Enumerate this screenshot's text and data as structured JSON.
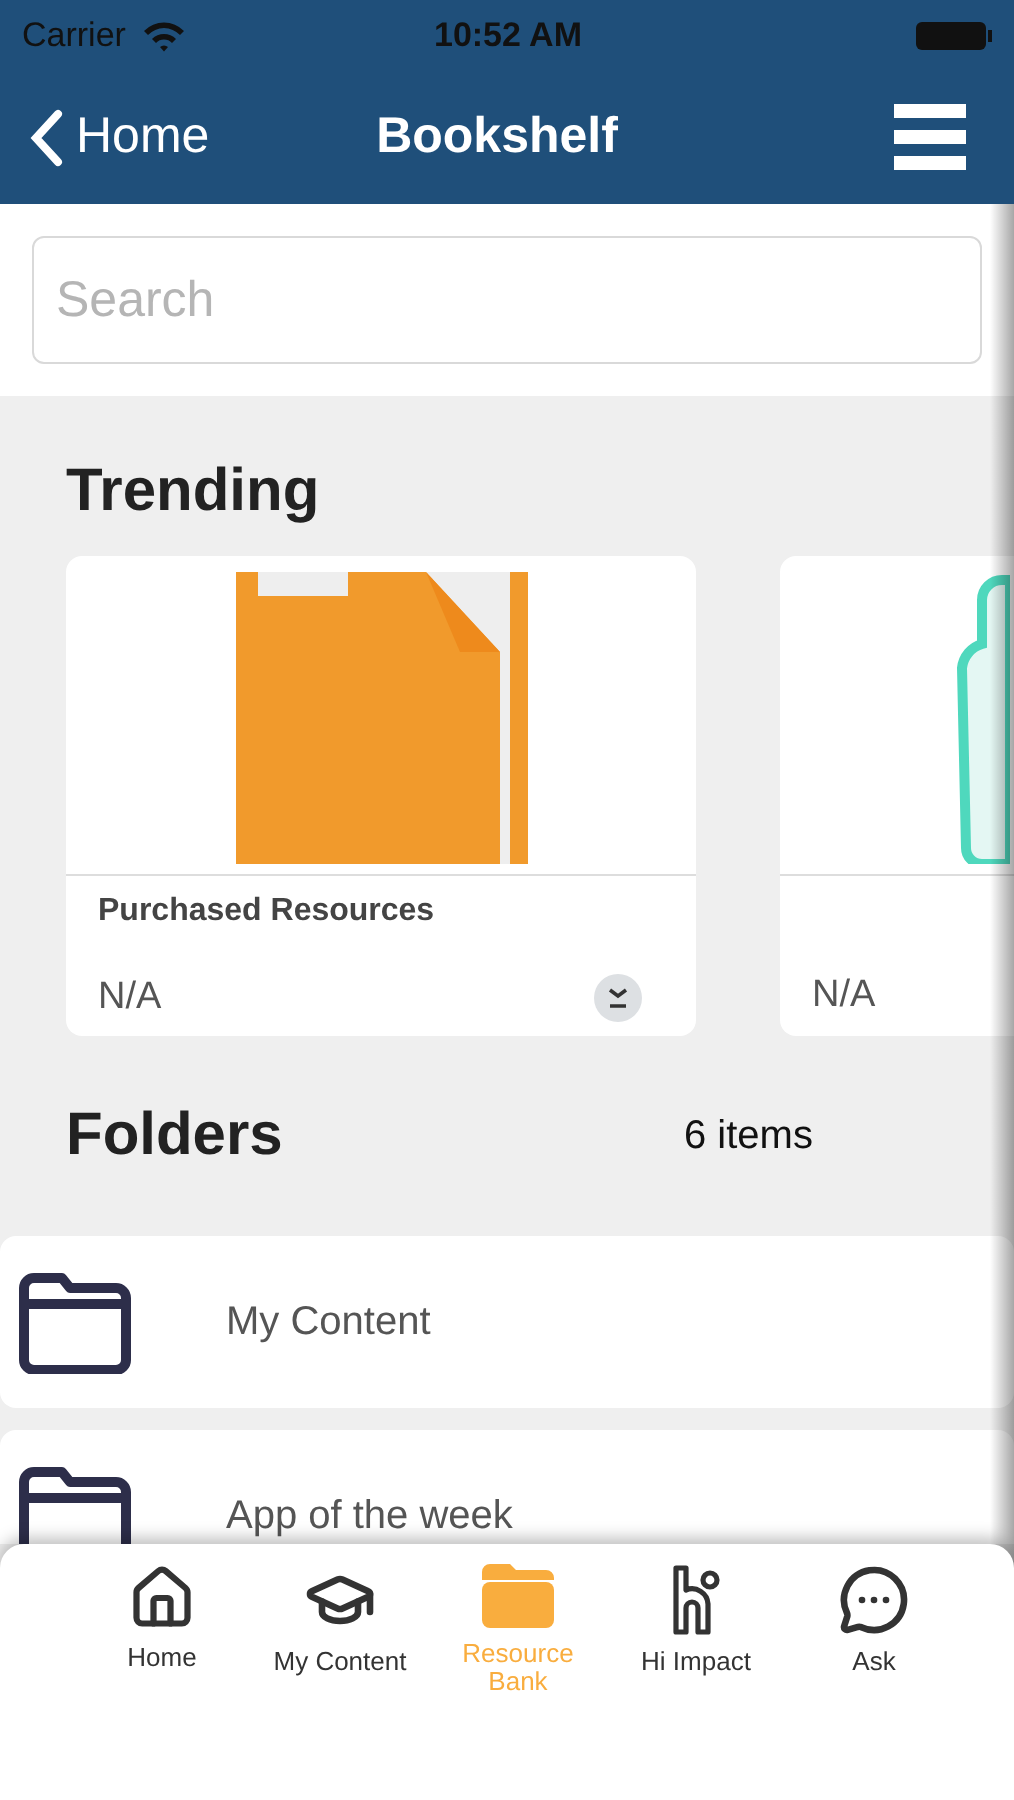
{
  "status_bar": {
    "carrier": "Carrier",
    "time": "10:52 AM"
  },
  "nav_bar": {
    "back": "Home",
    "title": "Bookshelf"
  },
  "search": {
    "placeholder": "Search"
  },
  "trending": {
    "heading": "Trending",
    "cards": [
      {
        "kind": "folder",
        "title": "Purchased Resources",
        "subtitle": "N/A",
        "expand": true
      },
      {
        "kind": "bottle",
        "subtitle": "N/A",
        "expand": false
      }
    ]
  },
  "folders": {
    "heading": "Folders",
    "count": "6 items",
    "items": [
      {
        "name": "My Content"
      },
      {
        "name": "App of the week"
      }
    ]
  },
  "tab_bar": [
    {
      "kind": "home",
      "label": "Home",
      "selected": false
    },
    {
      "kind": "cap",
      "label": "My Content",
      "selected": false
    },
    {
      "kind": "folder",
      "label": "Resource Bank",
      "selected": true
    },
    {
      "kind": "hi",
      "label": "Hi Impact",
      "selected": false
    },
    {
      "kind": "chat",
      "label": "Ask",
      "selected": false
    }
  ]
}
